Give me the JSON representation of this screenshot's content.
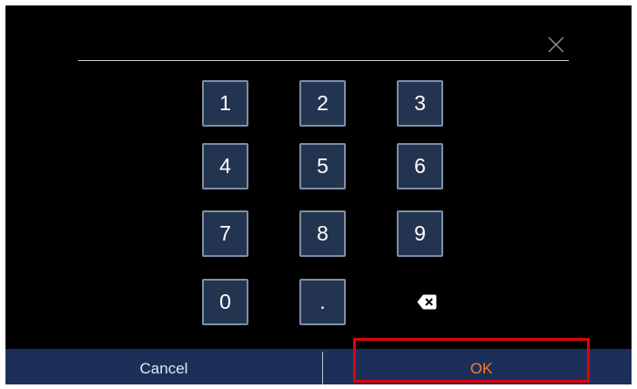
{
  "dialog": {
    "entry_value": "",
    "close_icon": "close-icon"
  },
  "keypad": {
    "keys": [
      "1",
      "2",
      "3",
      "4",
      "5",
      "6",
      "7",
      "8",
      "9",
      "0",
      "."
    ],
    "backspace_icon": "backspace-icon"
  },
  "footer": {
    "cancel_label": "Cancel",
    "ok_label": "OK"
  },
  "colors": {
    "background": "#000000",
    "key_fill": "#22344f",
    "key_border": "#7e8ea2",
    "action_bar": "#1b2f58",
    "ok_text": "#ff7a22",
    "highlight": "#e3000b"
  }
}
